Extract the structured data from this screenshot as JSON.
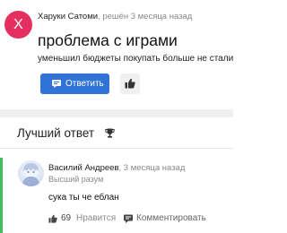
{
  "question": {
    "avatar_letter": "X",
    "author": "Харуки Сатоми",
    "separator": ",",
    "time": "решён 3 месяца назад",
    "title": "проблема с играми",
    "body": "уменьшил бюджеты покупать больше не стали",
    "answer_button_label": "Ответить",
    "answer_button_icon": "comment-icon",
    "like_button_icon": "thumbs-up-icon"
  },
  "best_answer": {
    "title": "Лучший ответ",
    "title_icon": "trophy-icon"
  },
  "answer": {
    "author": "Василий Андреев",
    "time": ", 3 месяца назад",
    "rank": "Высший разум",
    "body": "сука ты че еблан",
    "likes_count": "69",
    "like_label": "Нравится",
    "comment_label": "Комментировать"
  },
  "colors": {
    "accent_blue": "#2f73d6",
    "avatar_pink": "#e5305f",
    "best_answer_green": "#3dbd5c"
  }
}
